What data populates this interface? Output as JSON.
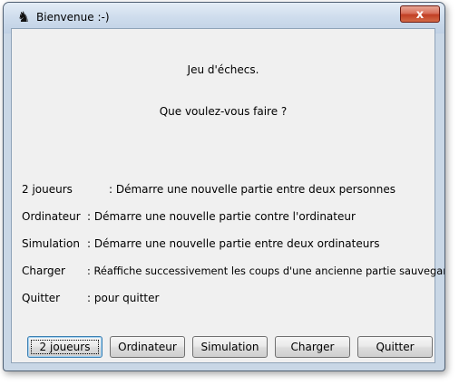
{
  "window": {
    "title": "Bienvenue :-)",
    "icon": "chess-piece-icon",
    "close_label": "x"
  },
  "intro": {
    "heading": "Jeu d'échecs.",
    "question": "Que voulez-vous faire ?"
  },
  "options": [
    {
      "label": "2 joueurs",
      "desc": ":  Démarre une nouvelle partie entre deux personnes"
    },
    {
      "label": "Ordinateur",
      "desc": ":  Démarre une nouvelle partie contre l'ordinateur"
    },
    {
      "label": "Simulation",
      "desc": ":  Démarre une nouvelle partie entre deux ordinateurs"
    },
    {
      "label": "Charger",
      "desc": ":  Réaffiche successivement les coups d'une ancienne partie sauvegardée"
    },
    {
      "label": "Quitter",
      "desc": ":  pour quitter"
    }
  ],
  "buttons": [
    {
      "label": "2 joueurs"
    },
    {
      "label": "Ordinateur"
    },
    {
      "label": "Simulation"
    },
    {
      "label": "Charger"
    },
    {
      "label": "Quitter"
    }
  ]
}
